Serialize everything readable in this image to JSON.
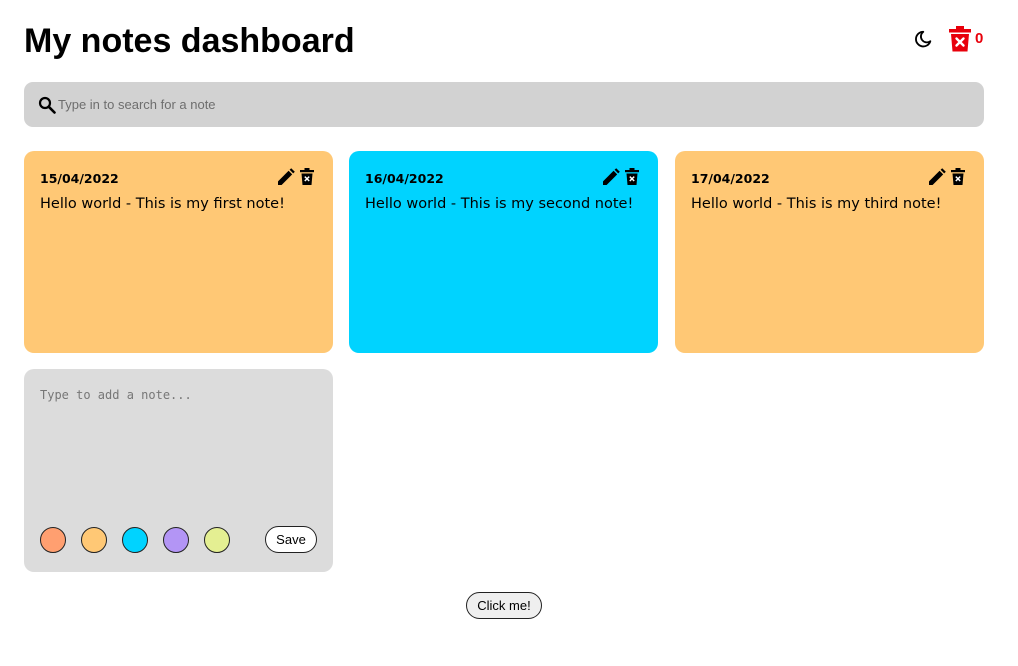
{
  "header": {
    "title": "My notes dashboard",
    "theme_icon": "moon-icon",
    "trash_icon": "trash-icon",
    "trash_count": "0",
    "trash_color": "#e8000b"
  },
  "search": {
    "placeholder": "Type in to search for a note",
    "icon": "search-icon"
  },
  "notes": [
    {
      "date": "15/04/2022",
      "text": "Hello world - This is my first note!",
      "color": "#ffc875"
    },
    {
      "date": "16/04/2022",
      "text": "Hello world - This is my second note!",
      "color": "#00d3ff"
    },
    {
      "date": "17/04/2022",
      "text": "Hello world - This is my third note!",
      "color": "#ffc875"
    }
  ],
  "new_note": {
    "placeholder": "Type to add a note...",
    "color_options": [
      "#ff9f70",
      "#ffc875",
      "#00d3ff",
      "#b395f5",
      "#e4ef92"
    ],
    "save_label": "Save"
  },
  "footer": {
    "button_label": "Click me!"
  }
}
